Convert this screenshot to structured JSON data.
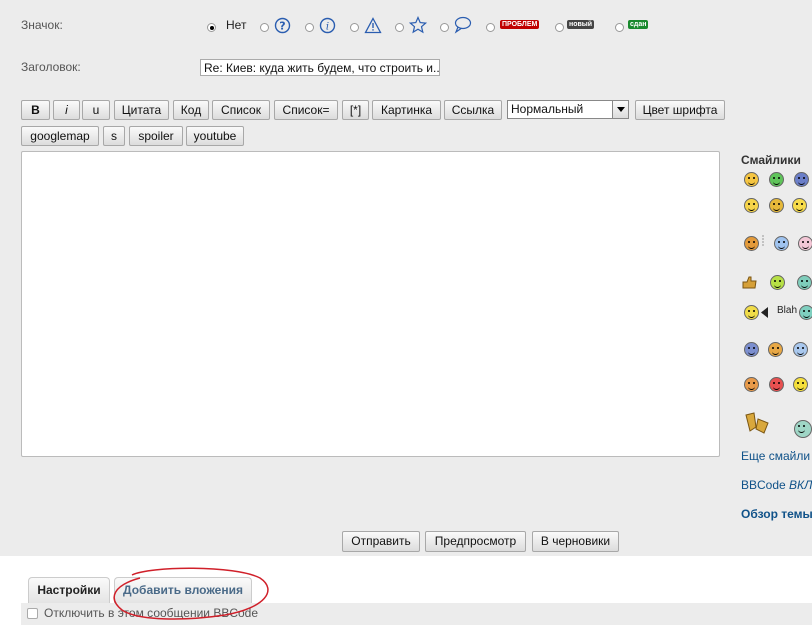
{
  "form": {
    "icon_label": "Значок:",
    "subject_label": "Заголовок:",
    "subject_value": "Re: Киев:  куда жить будем, что строить и..."
  },
  "icons": {
    "none_label": "Нет",
    "tag_problem": "ПРОБЛЕМ",
    "tag_new": "новый",
    "tag_done": "сдан",
    "colors": {
      "problem": "#c00000",
      "new": "#444444",
      "done": "#1a8a2e"
    }
  },
  "toolbar": {
    "bold": "B",
    "italic": "i",
    "underline": "u",
    "quote": "Цитата",
    "code": "Код",
    "list": "Список",
    "list_eq": "Список=",
    "list_item": "[*]",
    "image": "Картинка",
    "url": "Ссылка",
    "size_selected": "Нормальный",
    "font_color": "Цвет шрифта",
    "googlemap": "googlemap",
    "s": "s",
    "spoiler": "spoiler",
    "youtube": "youtube"
  },
  "smilies": {
    "title": "Смайлики",
    "blah": "Blah",
    "more": "Еще смайли",
    "bbcode": "BBCode ",
    "bbcode_state": "ВКЛ",
    "topic_review": "Обзор темы"
  },
  "actions": {
    "submit": "Отправить",
    "preview": "Предпросмотр",
    "draft": "В черновики"
  },
  "tabs": {
    "settings": "Настройки",
    "attachments": "Добавить вложения"
  },
  "options": {
    "disable_bbcode": "Отключить в этом сообщении BBCode"
  }
}
